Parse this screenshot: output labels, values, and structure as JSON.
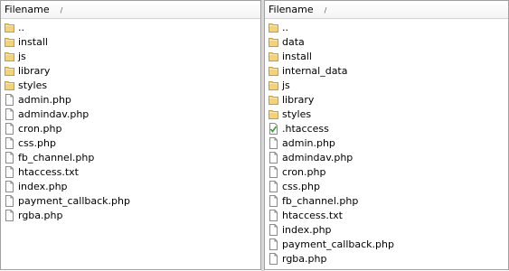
{
  "left_pane": {
    "column_header": "Filename",
    "sort_indicator": "/",
    "items": [
      {
        "name": "..",
        "type": "folder"
      },
      {
        "name": "install",
        "type": "folder"
      },
      {
        "name": "js",
        "type": "folder"
      },
      {
        "name": "library",
        "type": "folder"
      },
      {
        "name": "styles",
        "type": "folder"
      },
      {
        "name": "admin.php",
        "type": "file"
      },
      {
        "name": "admindav.php",
        "type": "file"
      },
      {
        "name": "cron.php",
        "type": "file"
      },
      {
        "name": "css.php",
        "type": "file"
      },
      {
        "name": "fb_channel.php",
        "type": "file"
      },
      {
        "name": "htaccess.txt",
        "type": "file"
      },
      {
        "name": "index.php",
        "type": "file"
      },
      {
        "name": "payment_callback.php",
        "type": "file"
      },
      {
        "name": "rgba.php",
        "type": "file"
      }
    ]
  },
  "right_pane": {
    "column_header": "Filename",
    "sort_indicator": "/",
    "items": [
      {
        "name": "..",
        "type": "folder"
      },
      {
        "name": "data",
        "type": "folder"
      },
      {
        "name": "install",
        "type": "folder"
      },
      {
        "name": "internal_data",
        "type": "folder"
      },
      {
        "name": "js",
        "type": "folder"
      },
      {
        "name": "library",
        "type": "folder"
      },
      {
        "name": "styles",
        "type": "folder"
      },
      {
        "name": ".htaccess",
        "type": "config"
      },
      {
        "name": "admin.php",
        "type": "file"
      },
      {
        "name": "admindav.php",
        "type": "file"
      },
      {
        "name": "cron.php",
        "type": "file"
      },
      {
        "name": "css.php",
        "type": "file"
      },
      {
        "name": "fb_channel.php",
        "type": "file"
      },
      {
        "name": "htaccess.txt",
        "type": "file"
      },
      {
        "name": "index.php",
        "type": "file"
      },
      {
        "name": "payment_callback.php",
        "type": "file"
      },
      {
        "name": "rgba.php",
        "type": "file"
      }
    ]
  },
  "colors": {
    "folder_fill": "#f3d27a",
    "folder_stroke": "#c9a02c",
    "file_fill": "#ffffff",
    "file_stroke": "#8a8a8a",
    "config_check": "#3a9a3a"
  }
}
